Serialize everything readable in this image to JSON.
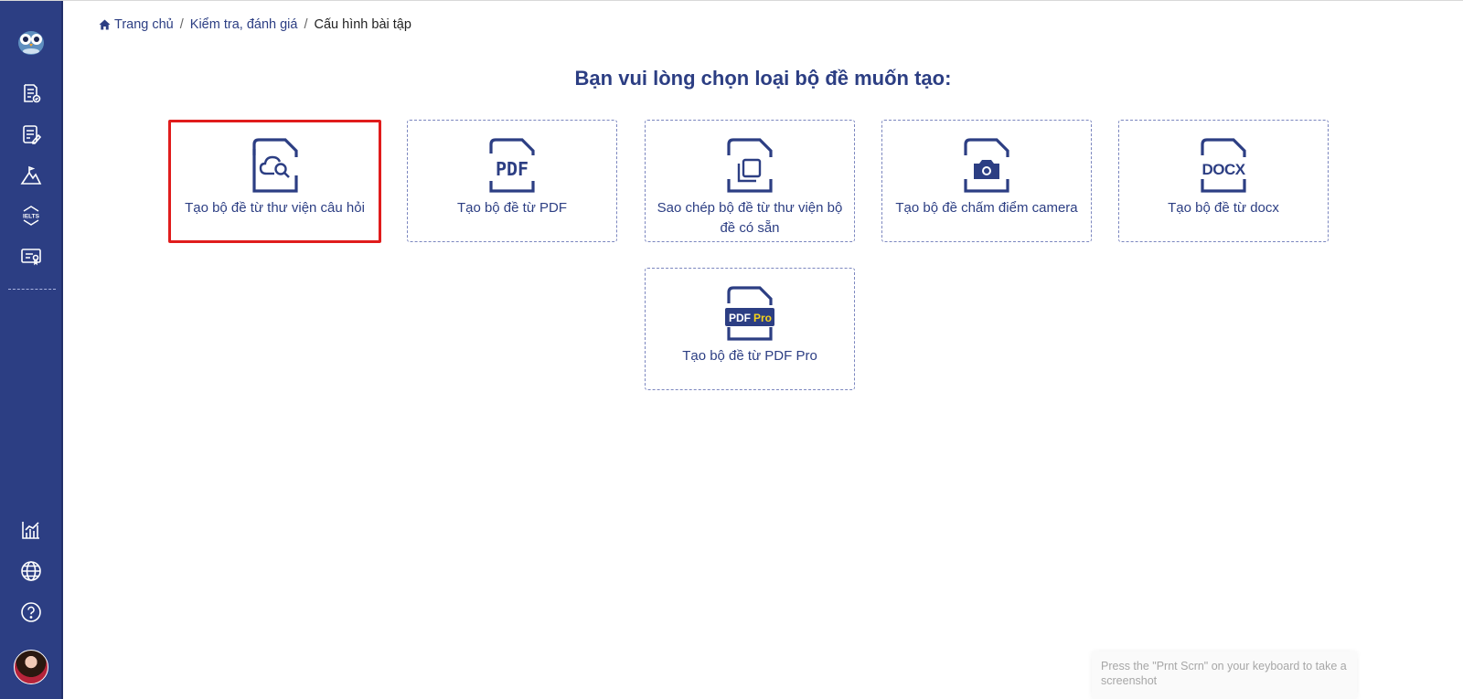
{
  "breadcrumb": {
    "home": "Trang chủ",
    "level2": "Kiểm tra, đánh giá",
    "current": "Cấu hình bài tập",
    "separator": "/"
  },
  "heading": "Bạn vui lòng chọn loại bộ đề muốn tạo:",
  "cards": [
    {
      "label": "Tạo bộ đề từ thư viện câu hỏi",
      "icon": "cloud-search-file-icon",
      "selected": true
    },
    {
      "label": "Tạo bộ đề từ PDF",
      "icon": "pdf-file-icon",
      "icon_text": "PDF",
      "selected": false
    },
    {
      "label": "Sao chép bộ đề từ thư viện bộ đề có sẵn",
      "icon": "copy-file-icon",
      "selected": false
    },
    {
      "label": "Tạo bộ đề chấm điểm camera",
      "icon": "camera-file-icon",
      "selected": false
    },
    {
      "label": "Tạo bộ đề từ docx",
      "icon": "docx-file-icon",
      "icon_text": "DOCX",
      "selected": false
    },
    {
      "label": "Tạo bộ đề từ PDF Pro",
      "icon": "pdf-pro-file-icon",
      "icon_text_1": "PDF",
      "icon_text_2": "Pro",
      "selected": false
    }
  ],
  "sidebar": {
    "ielts_label": "IELTS",
    "icons": [
      "owl-logo-icon",
      "exam-check-icon",
      "edit-document-icon",
      "mountain-flag-icon",
      "ielts-icon",
      "certificate-icon",
      "chart-icon",
      "globe-icon",
      "help-icon",
      "avatar"
    ]
  },
  "toast": "Press the \"Prnt Scrn\" on your keyboard to take a screenshot",
  "colors": {
    "sidebar": "#2c3e83",
    "primary_text": "#2c3e83",
    "selected_border": "#e01c1c",
    "pro_badge": "#f5d21a"
  }
}
